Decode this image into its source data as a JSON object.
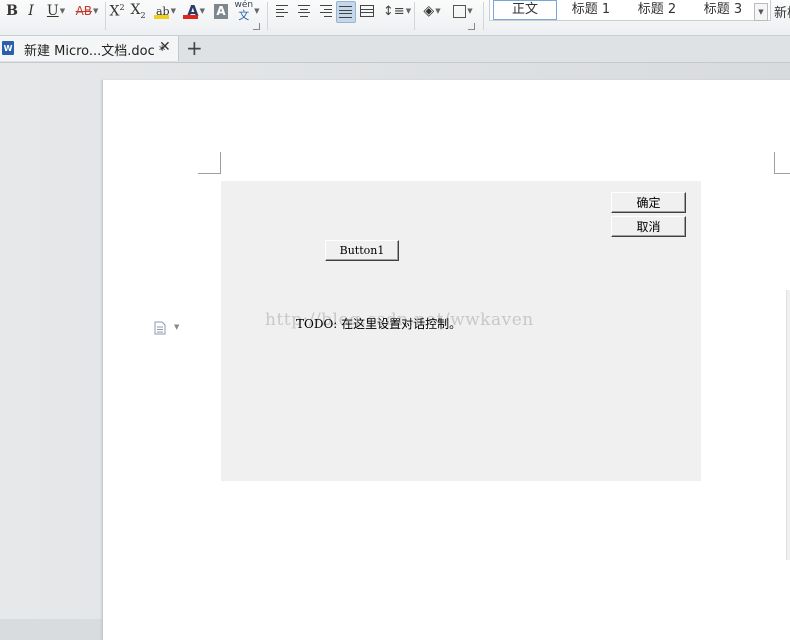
{
  "ribbon": {
    "bold": "B",
    "italic": "I",
    "underline": "U",
    "strikethrough": "AB",
    "superscript": "X",
    "superscript_mark": "2",
    "subscript": "X",
    "subscript_mark": "2",
    "highlight": "ab",
    "font_color": "A",
    "char_shading": "A",
    "pinyin_top": "wén",
    "pinyin_bottom": "文",
    "highlight_color": "#f1d01b",
    "font_color_value": "#e0261b",
    "styles": [
      "正文",
      "标题 1",
      "标题 2",
      "标题 3"
    ],
    "new_style": "新样"
  },
  "tabbar": {
    "doc_icon": "W",
    "tab_title": "新建 Micro...文档.doc *",
    "close": "✕",
    "add": "+"
  },
  "dialog": {
    "ok_label": "确定",
    "cancel_label": "取消",
    "button1_label": "Button1",
    "todo_text": "TODO: 在这里设置对话控制。",
    "watermark": "http://blog.csdn.net/wwkaven"
  }
}
